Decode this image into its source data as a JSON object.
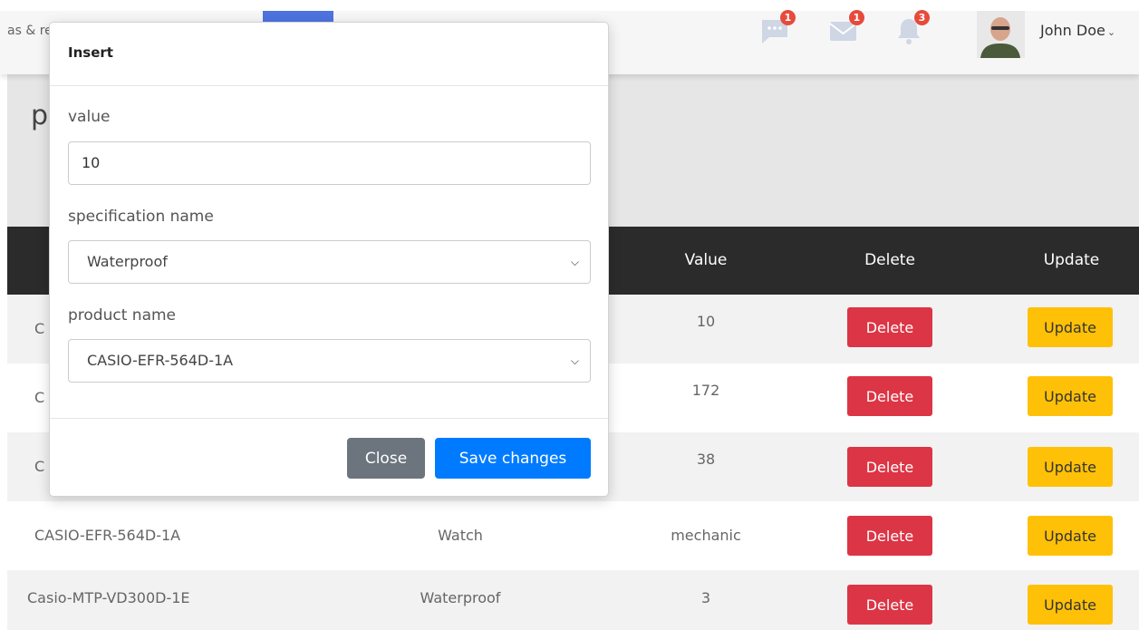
{
  "header": {
    "breadcrumb": "as & re",
    "user_name": "John Doe",
    "icons": [
      {
        "name": "chat-icon",
        "badge": "1",
        "color": "#cfd6e4"
      },
      {
        "name": "envelope-icon",
        "badge": "1",
        "color": "#cfd6e4"
      },
      {
        "name": "bell-icon",
        "badge": "3",
        "color": "#cfd6e4"
      }
    ]
  },
  "page": {
    "title": "pe"
  },
  "table": {
    "columns": [
      "Value",
      "Delete",
      "Update"
    ],
    "rows": [
      {
        "product": "C",
        "spec": "",
        "value": "10",
        "delete": "Delete",
        "update": "Update"
      },
      {
        "product": "C",
        "spec": "",
        "value": "172",
        "delete": "Delete",
        "update": "Update"
      },
      {
        "product": "C",
        "spec": "",
        "value": "38",
        "delete": "Delete",
        "update": "Update"
      },
      {
        "product": "CASIO-EFR-564D-1A",
        "spec": "Watch",
        "value": "mechanic",
        "delete": "Delete",
        "update": "Update"
      },
      {
        "product": "Casio-MTP-VD300D-1E",
        "spec": "Waterproof",
        "value": "3",
        "delete": "Delete",
        "update": "Update"
      }
    ]
  },
  "modal": {
    "title": "Insert",
    "value_label": "value",
    "value": "10",
    "spec_label": "specification name",
    "spec_selected": "Waterproof",
    "product_label": "product name",
    "product_selected": "CASIO-EFR-564D-1A",
    "close_label": "Close",
    "save_label": "Save changes"
  },
  "colors": {
    "danger": "#dc3545",
    "warning": "#ffc107",
    "primary": "#007bff",
    "secondary": "#6c757d",
    "table_header": "#2b2b2b"
  }
}
